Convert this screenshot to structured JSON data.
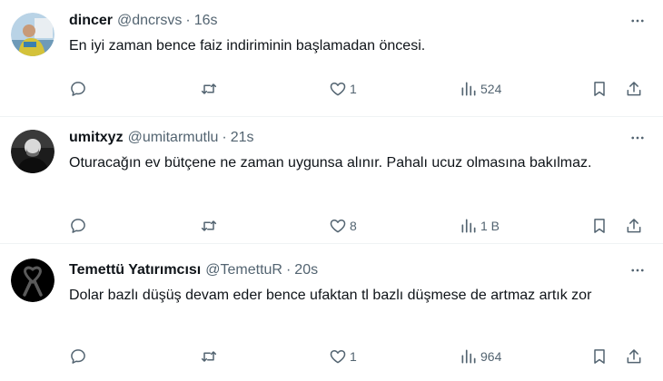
{
  "tweets": [
    {
      "name": "dincer",
      "handle": "@dncrsvs",
      "dot": "·",
      "time": "16s",
      "text": "En iyi zaman bence faiz indiriminin başlamadan öncesi.",
      "replies": "",
      "retweets": "",
      "likes": "1",
      "views": "524"
    },
    {
      "name": "umitxyz",
      "handle": "@umitarmutlu",
      "dot": "·",
      "time": "21s",
      "text": "Oturacağın ev bütçene ne zaman uygunsa alınır. Pahalı ucuz olmasına bakılmaz.",
      "replies": "",
      "retweets": "",
      "likes": "8",
      "views": "1 B"
    },
    {
      "name": "Temettü Yatırımcısı",
      "handle": "@TemettuR",
      "dot": "·",
      "time": "20s",
      "text": "Dolar bazlı düşüş devam eder bence ufaktan tl bazlı düşmese de artmaz artık zor",
      "replies": "",
      "retweets": "",
      "likes": "1",
      "views": "964"
    }
  ],
  "icons": {
    "reply": "reply-icon",
    "retweet": "retweet-icon",
    "like": "heart-icon",
    "views": "views-icon",
    "bookmark": "bookmark-icon",
    "share": "share-icon",
    "more": "more-icon"
  },
  "colors": {
    "text": "#0f1419",
    "secondary": "#536471",
    "divider": "#eff3f4"
  }
}
